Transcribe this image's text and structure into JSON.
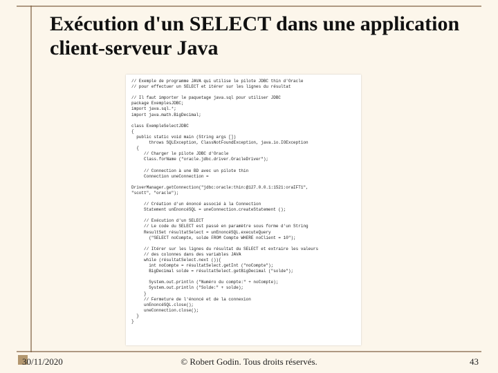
{
  "title": "Exécution d'un SELECT dans une application client-serveur Java",
  "code": "// Exemple de programme JAVA qui utilise le pilote JDBC thin d'Oracle\n// pour effectuer un SELECT et itérer sur les lignes du résultat\n\n// Il faut importer le paquetage java.sql pour utiliser JDBC\npackage ExemplesJDBC;\nimport java.sql.*;\nimport java.math.BigDecimal;\n\nclass ExempleSelectJDBC\n{\n  public static void main (String args [])\n       throws SQLException, ClassNotFoundException, java.io.IOException\n  {\n     // Charger le pilote JDBC d'Oracle\n     Class.forName (\"oracle.jdbc.driver.OracleDriver\");\n\n     // Connection à une BD avec un pilote thin\n     Connection uneConnection =\n\nDriverManager.getConnection(\"jdbc:oracle:thin:@127.0.0.1:1521:oraIFT1\",\n\"scott\", \"oracle\");\n\n     // Création d'un énoncé associé à la Connection\n     Statement unEnoncéSQL = uneConnection.createStatement ();\n\n     // Exécution d'un SELECT\n     // Le code du SELECT est passé en paramètre sous forme d'un String\n     ResultSet résultatSelect = unEnoncéSQL.executeQuery\n       (\"SELECT noCompte, solde FROM Compte WHERE noClient = 10\");\n\n     // Itérer sur les lignes du résultat du SELECT et extraire les valeurs\n     // des colonnes dans des variables JAVA\n     while (résultatSelect.next ()){\n       int noCompte = résultatSelect.getInt (\"noCompte\");\n       BigDecimal solde = résultatSelect.getBigDecimal (\"solde\");\n\n       System.out.println (\"Numéro du compte:\" + noCompte);\n       System.out.println (\"Solde:\" + solde);\n     }\n     // Fermeture de l'énoncé et de la connexion\n     unEnoncéSQL.close();\n     uneConnection.close();\n  }\n}",
  "footer": {
    "date": "30/11/2020",
    "copyright": "© Robert Godin. Tous droits réservés.",
    "page": "43"
  }
}
